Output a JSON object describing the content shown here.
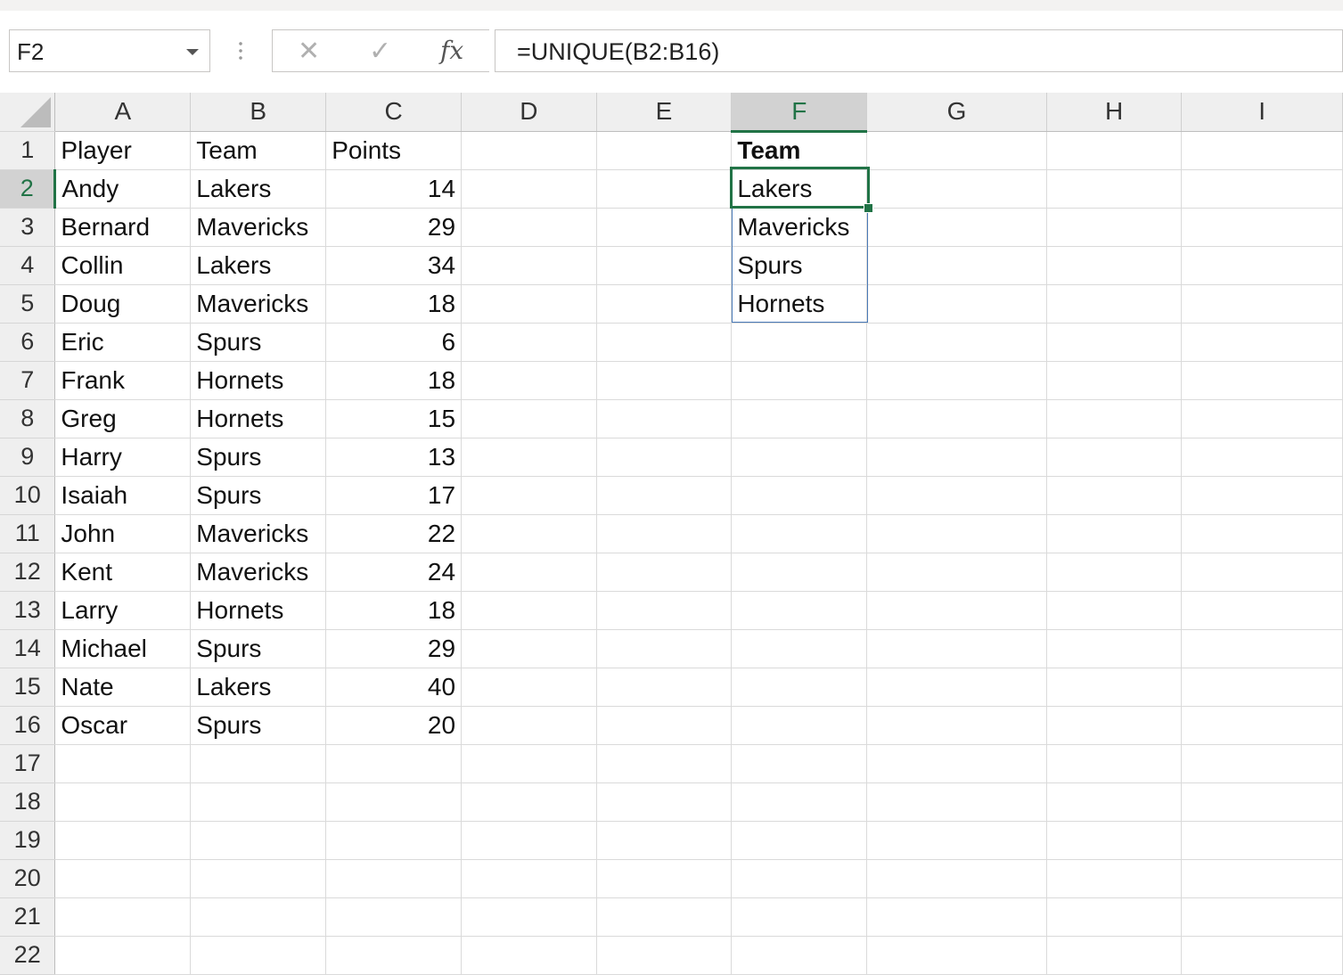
{
  "name_box": {
    "value": "F2"
  },
  "formula_bar": {
    "cancel_glyph": "✕",
    "enter_glyph": "✓",
    "function_glyph": "fx",
    "formula": "=UNIQUE(B2:B16)"
  },
  "columns": [
    "A",
    "B",
    "C",
    "D",
    "E",
    "F",
    "G",
    "H",
    "I"
  ],
  "active_column": "F",
  "active_row": 2,
  "rows": [
    {
      "n": "1",
      "A": "Player",
      "B": "Team",
      "C": "Points",
      "F": "Team"
    },
    {
      "n": "2",
      "A": "Andy",
      "B": "Lakers",
      "C": "14",
      "F": "Lakers"
    },
    {
      "n": "3",
      "A": "Bernard",
      "B": "Mavericks",
      "C": "29",
      "F": "Mavericks"
    },
    {
      "n": "4",
      "A": "Collin",
      "B": "Lakers",
      "C": "34",
      "F": "Spurs"
    },
    {
      "n": "5",
      "A": "Doug",
      "B": "Mavericks",
      "C": "18",
      "F": "Hornets"
    },
    {
      "n": "6",
      "A": "Eric",
      "B": "Spurs",
      "C": "6",
      "F": ""
    },
    {
      "n": "7",
      "A": "Frank",
      "B": "Hornets",
      "C": "18",
      "F": ""
    },
    {
      "n": "8",
      "A": "Greg",
      "B": "Hornets",
      "C": "15",
      "F": ""
    },
    {
      "n": "9",
      "A": "Harry",
      "B": "Spurs",
      "C": "13",
      "F": ""
    },
    {
      "n": "10",
      "A": "Isaiah",
      "B": "Spurs",
      "C": "17",
      "F": ""
    },
    {
      "n": "11",
      "A": "John",
      "B": "Mavericks",
      "C": "22",
      "F": ""
    },
    {
      "n": "12",
      "A": "Kent",
      "B": "Mavericks",
      "C": "24",
      "F": ""
    },
    {
      "n": "13",
      "A": "Larry",
      "B": "Hornets",
      "C": "18",
      "F": ""
    },
    {
      "n": "14",
      "A": "Michael",
      "B": "Spurs",
      "C": "29",
      "F": ""
    },
    {
      "n": "15",
      "A": "Nate",
      "B": "Lakers",
      "C": "40",
      "F": ""
    },
    {
      "n": "16",
      "A": "Oscar",
      "B": "Spurs",
      "C": "20",
      "F": ""
    },
    {
      "n": "17",
      "A": "",
      "B": "",
      "C": "",
      "F": ""
    },
    {
      "n": "18",
      "A": "",
      "B": "",
      "C": "",
      "F": ""
    },
    {
      "n": "19",
      "A": "",
      "B": "",
      "C": "",
      "F": ""
    },
    {
      "n": "20",
      "A": "",
      "B": "",
      "C": "",
      "F": ""
    },
    {
      "n": "21",
      "A": "",
      "B": "",
      "C": "",
      "F": ""
    },
    {
      "n": "22",
      "A": "",
      "B": "",
      "C": "",
      "F": ""
    }
  ],
  "colors": {
    "accent_green": "#217346",
    "spill_blue": "#4a7ab8",
    "header_bg": "#efefef"
  }
}
